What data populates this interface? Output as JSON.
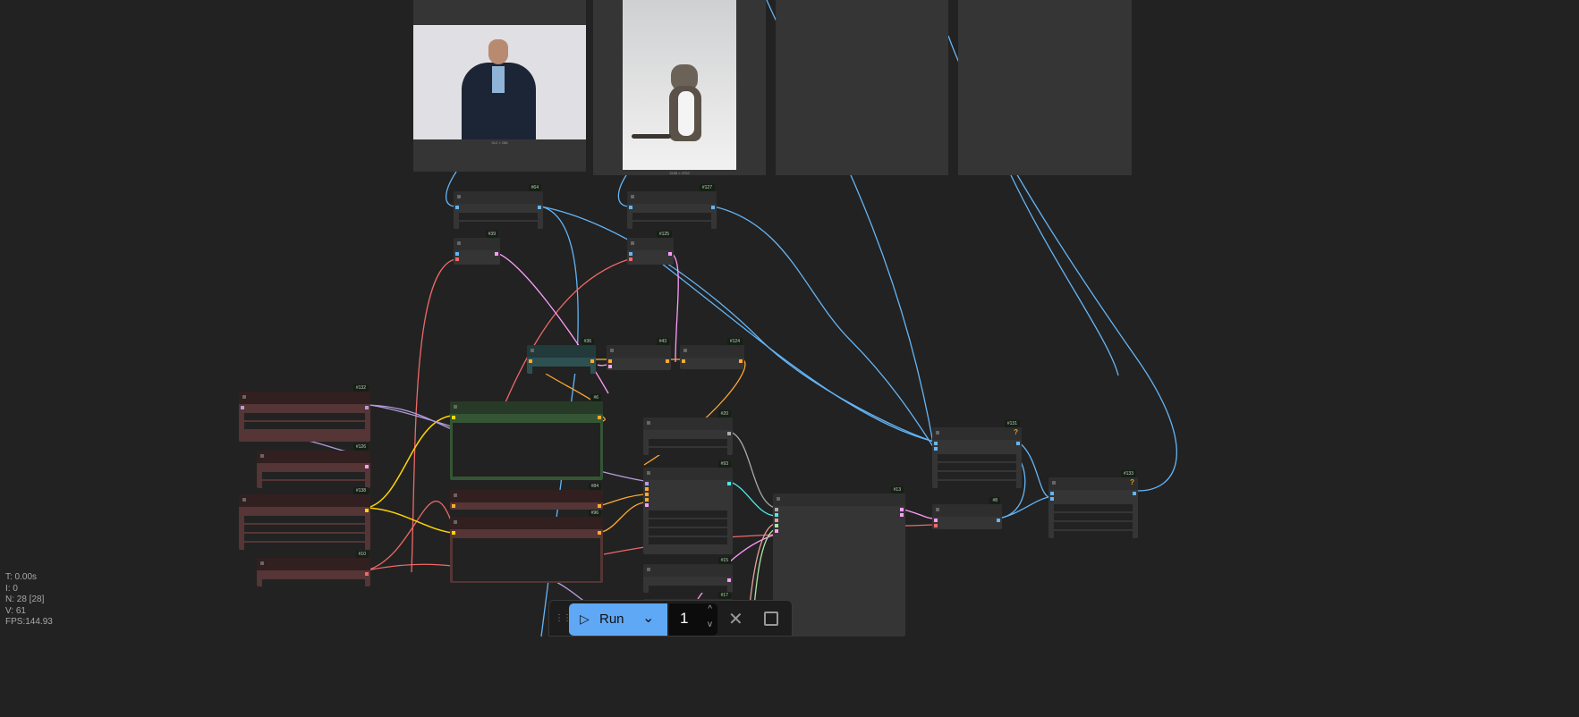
{
  "stats": {
    "time": "T: 0.00s",
    "iterations": "I: 0",
    "nodes": "N: 28 [28]",
    "vertices": "V: 61",
    "fps": "FPS:144.93"
  },
  "toolbar": {
    "run_label": "Run",
    "batch_count": "1",
    "run_color": "#5fa8f6"
  },
  "images": [
    {
      "size_label": "512 × 288"
    },
    {
      "size_label": "3168 × 4752"
    }
  ],
  "nodes": [
    {
      "id": "#64"
    },
    {
      "id": "#39"
    },
    {
      "id": "#127"
    },
    {
      "id": "#125"
    },
    {
      "id": "#36"
    },
    {
      "id": "#43"
    },
    {
      "id": "#124"
    },
    {
      "id": "#132"
    },
    {
      "id": "#6"
    },
    {
      "id": "#126"
    },
    {
      "id": "#138"
    },
    {
      "id": "#84"
    },
    {
      "id": "#96"
    },
    {
      "id": "#10"
    },
    {
      "id": "#20"
    },
    {
      "id": "#93"
    },
    {
      "id": "#15"
    },
    {
      "id": "#17"
    },
    {
      "id": "#13"
    },
    {
      "id": "#131"
    },
    {
      "id": "#8"
    },
    {
      "id": "#133"
    }
  ],
  "colors": {
    "background": "#222222",
    "node": "#353535",
    "image_wire": "#64b5f6",
    "clip_wire": "#f06868",
    "conditioning_wire": "#ffa931",
    "model_wire": "#b39ddb",
    "latent_wire": "#ff9cf9",
    "vae_wire": "#ffd500"
  }
}
